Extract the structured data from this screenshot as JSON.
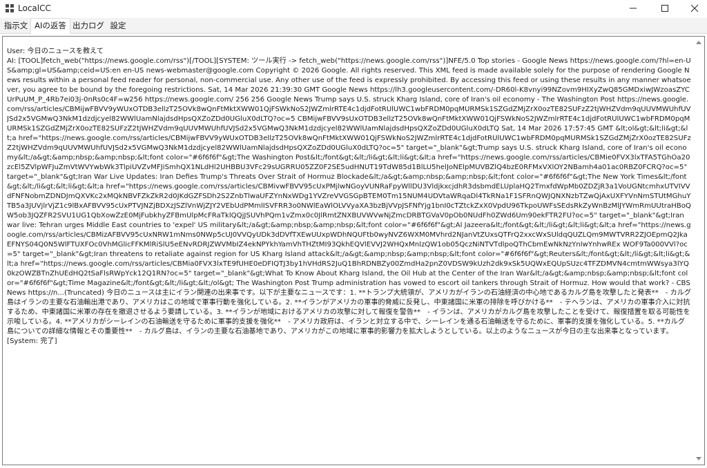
{
  "window": {
    "title": "LocalCC",
    "icon": "app-icon",
    "controls": [
      "minimize-icon",
      "maximize-icon",
      "close-icon"
    ]
  },
  "tabs": [
    {
      "label": "指示文",
      "active": false
    },
    {
      "label": "AIの返答",
      "active": true
    },
    {
      "label": "出力ログ",
      "active": false
    },
    {
      "label": "設定",
      "active": false
    }
  ],
  "response": {
    "text": "User: 今日のニュースを教えて\nAI: [TOOL]fetch_web(\"https://news.google.com/rss\")[/TOOL][SYSTEM: ツール実行 -> fetch_web(\"https://news.google.com/rss\")]NFE/5.0 Top stories - Google News https://news.google.com/?hl=en-US&amp;gl=US&amp;ceid=US:en en-US news-webmaster@google.com Copyright © 2026 Google. All rights reserved. This XML feed is made available solely for the purpose of rendering Google News results within a personal feed reader for personal, non-commercial use. Any other use of the feed is expressly prohibited. By accessing this feed or using these results in any manner whatsoever, you agree to be bound by the foregoing restrictions. Sat, 14 Mar 2026 21:39:30 GMT Google News https://lh3.googleusercontent.com/-DR60l-K8vnyi99NZovm9HIXyZwQ85GMDxiwJWzoasZYCUrPuUM_P_4Rb7ei03j-0nRs0c4F=w256 https://news.google.com/ 256 256 Google News Trump says U.S. struck Kharg Island, core of Iran's oil economy - The Washington Post https://news.google.com/rss/articles/CBMijwFBVV9yWUxOTDB3ellzT25OVk8wQnFtMktXWW01QjFSWkNoS2JWZmlrRTE4c1djdFotRUlUWC1wbFRDM0pqMURMSk1SZGdZMjZrX0ozTE82SUFzZ2tjWHZVdm9qUUVMWUhfUVJSd2x5VGMwQ3NkM1dzdjcyel82WWlUamNlajdsdHpsQXZoZDd0UGluX0dLTQ?oc=5 CBMijwFBVV9sUxOTDB3ellzT25OVk8wQnFtMktXWW01QjFSWkNoS2JWZmlrRTE4c1djdFotRUlUWC1wbFRDM0pqMURMSk1SZGdZMjZrX0ozTE82SUFzZ2tjWHZVdm9qUUVMWUhfUVJSd2x5VGMwQ3NkM1dzdjcyel82WWlUamNlajdsdHpsQXZoZDd0UGluX0dLTQ Sat, 14 Mar 2026 17:57:45 GMT &lt;ol&gt;&lt;li&gt;&lt;a href=\"https://news.google.com/rss/articles/CBMijwFBVV9yWUxOTDB3ellzT25OVk8wQnFtMktXWW01QjFSWkNoS2JWZmlrRTE4c1djdFotRUlUWC1wbFRDM0pqMURMSk1SZGdZMjZrX0ozTE82SUFzZ2tjWHZVdm9qUUVMWUhfUVJSd2x5VGMwQ3NkM1dzdjcyel82WWlUamNlajdsdHpsQXZoZDd0UGluX0dLTQ?oc=5\" target=\"_blank\"&gt;Trump says U.S. struck Kharg Island, core of Iran's oil economy&lt;/a&gt;&amp;nbsp;&amp;nbsp;&lt;font color=\"#6f6f6f\"&gt;The Washington Post&lt;/font&gt;&lt;/li&gt;&lt;li&gt;&lt;a href=\"https://news.google.com/rss/articles/CBMie0FVX3lxTFA5TGhOa20zcEl5ZVlpWFJuZmVtWVYwbWk3TlpiUVZvMFJiSmhQX1NLdHl2UHBBU3VFc29sUGRRU05ZZ0F2SE5udHNUT19TdW85d1BlLU5helJoNElpMUVBZlQ4bzE0RFMxVXlOY2NBamh4a01ac0RBZ0FCRQ?oc=5\" target=\"_blank\"&gt;Iran War Live Updates: Iran Defies Trump's Threats Over Strait of Hormuz Blockade&lt;/a&gt;&amp;nbsp;&amp;nbsp;&lt;font color=\"#6f6f6f\"&gt;The New York Times&lt;/font&gt;&lt;/li&gt;&lt;li&gt;&lt;a href=\"https://news.google.com/rss/articles/CBMivwFBVV95cUxPMjlwNGoyVUNRaFpyWllDU3VldjkxcjdhR3dsbmdELUplaHQ2TmxfdWpMb0ZDZjR3a1VoUGNtcmhxUTVIVVdFNFNobmZDNDJmQXVKc2xMQkNBVFZkZkR2d0JKdGZFSDh2S2ZnbTlwaUFZYnNxWDg1YVZreVVGSGpBTEM0Tm15NUM4UDVtaWRqaDl4TkRNa1F1SFRnQWJQNXNzbTZwQjAxUXFYVnNmSTUtMGhuYTB5a3JUVjlrVjZ1c9lBxAFBVV95cUxPTVJNZjBDXzJSZlVnWjZJY2VEbUdPMmlISVFRR3o0NWlEaWlOLVVyaXA3bzBjVVpJSFNfYjg1bnI0cTZtckZxX0VpdU96TkpoUWFsSEdsRkZyWnBzMlJYWmRmUUtraHBoQW5ob3JQZFR2SVU1UG1QbXowZzE0MjFubkhyZFBmUlpMcFRaTklQQjJSUVhPQm1vZmx0c0JlRmtZNXBUVWVwNjZmcDRBTGVaV0pOb0NUdFh0ZWd6Um90ekFTR2FU?oc=5\" target=\"_blank\"&gt;Iran war live: Tehran urges Middle East countries to 'expel' US military&lt;/a&gt;&amp;nbsp;&amp;nbsp;&lt;font color=\"#6f6f6f\"&gt;Al Jazeera&lt;/font&gt;&lt;/li&gt;&lt;li&gt;&lt;a href=\"https://news.google.com/rss/articles/CBMizAFBVV95cUxNRW1mNms0NWp5cUJ0VVQyUDk3dDVfTXEwUUxpWDhNQUFtb0wyNVZ6WXM0MVhrd2NJanVtZUxsQTFrQ2xxcWxSUldqQUZLQm9MWTVRR2ZJOEpmQ2JkaEFNYS04Q0N5WlFTUXFOc0VhMGlicFFKMlRiSlU5eENvRDRJZWVMbIZ4ekNPYkhYamVhTHZtMI93QkhEQVlEVVJ2WHQxMnlzQW1ob05QczNiNTVTdlpoQThCbmEwNkNzYnlwYnhwREx WOF9Ta000VVl?oc=5\" target=\"_blank\"&gt;Iran threatens to retaliate against region for US Kharg Island attack&lt;/a&gt;&amp;nbsp;&amp;nbsp;&lt;font color=\"#6f6f6f\"&gt;Reuters&lt;/font&gt;&lt;/li&gt;&lt;li&gt;&lt;a href=\"https://news.google.com/rss/articles/CBMia0FVX3lxTE9fUHE0eDFIQTJ3by1hVHdRS2JuQ1BhRDNBZy00ZmdHa2pnZ0VDSW9kUzh2dk9xSk5UQWxEQUpSUzc4TFZDMVN4cmtmWWsya3lYQ0kzOWZBTnZhUEdHQ2tSaFlsRWpYck12Q1RN?oc=5\" target=\"_blank\"&gt;What To Know About Kharg Island, the Oil Hub at the Center of the Iran War&lt;/a&gt;&amp;nbsp;&amp;nbsp;&lt;font color=\"#6f6f6f\"&gt;Time Magazine&lt;/font&gt;&lt;/li&gt;&lt;/ol&gt; The Washington Post Trump administration has vowed to escort oil tankers through Strait of Hormuz. How would that work? - CBS News https://n...(Truncated) 今日のニュースは主にイラン関連の出来事です。以下が主要なニュースです：1. **トランプ大統領が、アメリカがイランの石油経済の中心地であるカルグ島を攻撃したと発表**　- カルグ島はイランの主要な石油輸出港であり、アメリカはこの地域で軍事行動を強化している。2. **イランがアメリカの軍事的脅威に反発し、中東諸国に米軍の排除を呼びかける**　- テヘランは、アメリカの軍事介入に対抗するため、中東諸国に米軍の存在を撤退させるよう要請している。3. **イランが地域におけるアメリカの攻撃に対して報復を警告**　- イランは、アメリカがカルグ島を攻撃したことを受けて、報復措置を取る可能性を示唆している。4. **アメリカがシーレインの石油輸送を守るために軍事的支援を強化**　- アメリカ政府は、イランと対立する中で、シーレインを通る石油輸送を守るために、軍事的支援を強化している。5. **カルグ島についての詳細な情報とその重要性**　- カルグ島は、イランの主要な石油基地であり、アメリカがこの地域に軍事的影響力を拡大しようとしている。以上のようなニュースが今日の主な出来事となっています。\n[System: 完了]"
  }
}
